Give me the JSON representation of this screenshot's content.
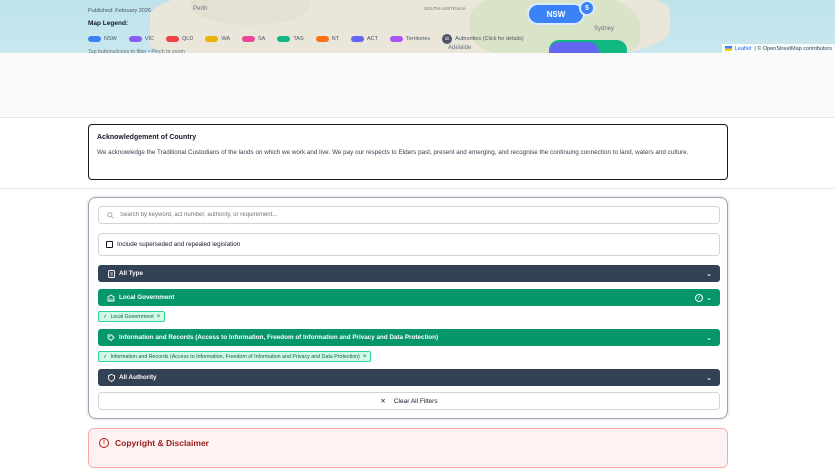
{
  "map": {
    "labels": [
      "Perth",
      "SOUTH AUSTRALIA",
      "Adelaide",
      "Sydney"
    ],
    "nsw_marker": "NSW",
    "cluster_count": "5",
    "attribution_link": "Leaflet",
    "attribution_text": "| © OpenStreetMap contributors"
  },
  "legend": {
    "published": "Published: February 2026",
    "title": "Map Legend:",
    "items": [
      {
        "label": "NSW",
        "color": "#3b82f6"
      },
      {
        "label": "VIC",
        "color": "#8b5cf6"
      },
      {
        "label": "QLD",
        "color": "#ef4444"
      },
      {
        "label": "WA",
        "color": "#eab308"
      },
      {
        "label": "SA",
        "color": "#ec4899"
      },
      {
        "label": "TAS",
        "color": "#10b981"
      },
      {
        "label": "NT",
        "color": "#f97316"
      },
      {
        "label": "ACT",
        "color": "#6366f1"
      },
      {
        "label": "Territories",
        "color": "#a855f7"
      }
    ],
    "authorities_label": "Authorities (Click for details)",
    "hint": "Tap buttons/icons to filter • Pinch to zoom"
  },
  "acknowledgement": {
    "title": "Acknowledgement of Country",
    "body": "We acknowledge the Traditional Custodians of the lands on which we work and live. We pay our respects to Elders past, present and emerging, and recognise the continuing connection to land, waters and culture."
  },
  "filters": {
    "search_placeholder": "Search by keyword, act number, authority, or requirement...",
    "include_superseded": "Include superseded and repealed legislation",
    "type_label": "All Type",
    "local_government_label": "Local Government",
    "local_government_chip": "Local Government",
    "info_records_label": "Information and Records (Access to Information, Freedom of Information and Privacy and Data Protection)",
    "info_records_chip": "Information and Records (Access to Information, Freedom of Information and Privacy and Data Protection)",
    "authority_label": "All Authority",
    "clear_label": "Clear All Filters"
  },
  "copyright": {
    "title": "Copyright & Disclaimer"
  },
  "colors": {
    "dark_bar": "#334155",
    "green_bar": "#059669",
    "chip_bg": "#d1fae5"
  }
}
